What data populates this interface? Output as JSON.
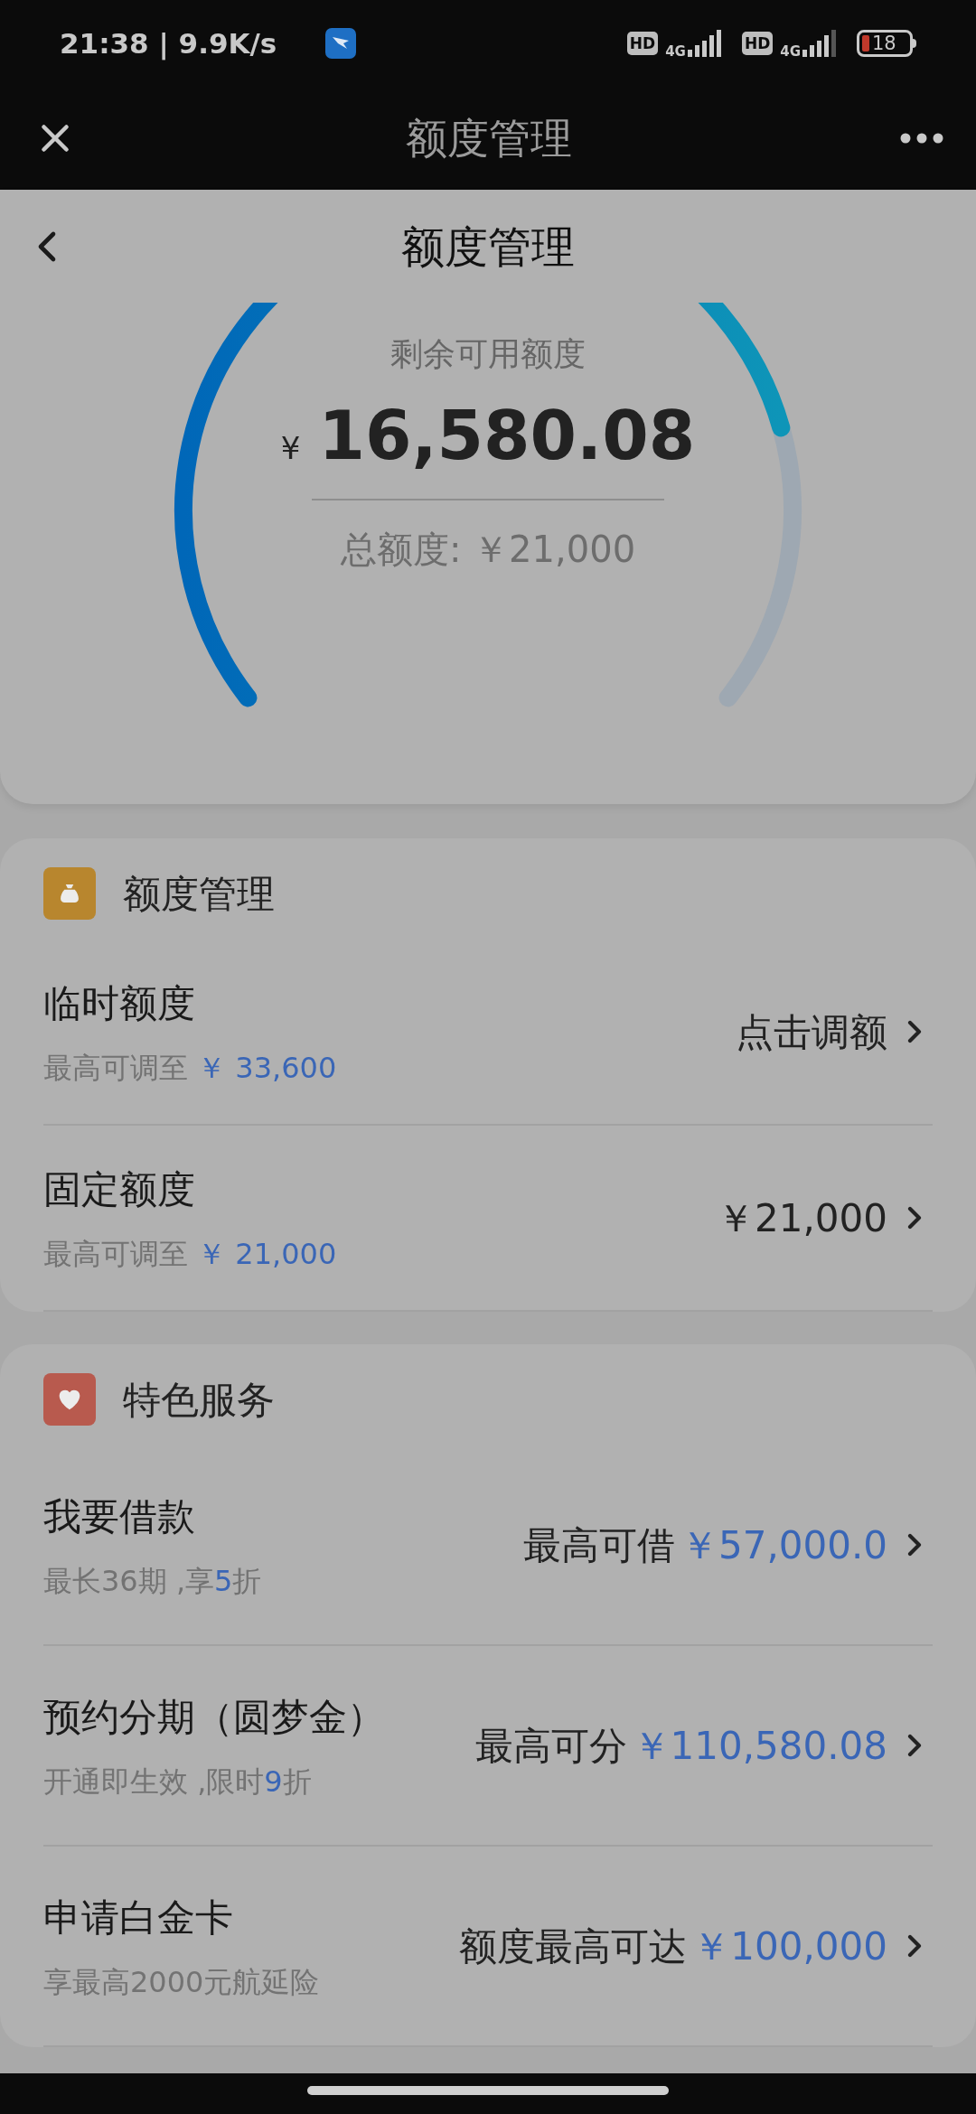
{
  "status_bar": {
    "time": "21:38 | 9.9K/s",
    "sims": [
      {
        "badge": "HD",
        "network": "4G"
      },
      {
        "badge": "HD",
        "network": "4G"
      }
    ],
    "battery": "18"
  },
  "top_bar": {
    "title": "额度管理"
  },
  "header": {
    "title": "额度管理"
  },
  "gauge": {
    "label": "剩余可用额度",
    "currency": "¥",
    "amount": "16,580.08",
    "total": "总额度: ￥21,000"
  },
  "sections": [
    {
      "title": "额度管理",
      "color": "#b8862e",
      "rows": [
        {
          "title": "临时额度",
          "subtitle": [
            {
              "text": "最高可调至 ",
              "kind": "plain"
            },
            {
              "text": "￥ 33,600",
              "kind": "accent"
            }
          ],
          "right": [
            {
              "text": "点击调额",
              "kind": "plain"
            }
          ]
        },
        {
          "title": "固定额度",
          "subtitle": [
            {
              "text": "最高可调至 ",
              "kind": "plain"
            },
            {
              "text": "￥ 21,000",
              "kind": "accent"
            }
          ],
          "right": [
            {
              "text": "￥21,000",
              "kind": "plain"
            }
          ]
        }
      ]
    },
    {
      "title": "特色服务",
      "color": "#b85a4e",
      "rows": [
        {
          "title": "我要借款",
          "subtitle": [
            {
              "text": "最长36期 ,享",
              "kind": "plain"
            },
            {
              "text": "5",
              "kind": "accent"
            },
            {
              "text": "折",
              "kind": "plain"
            }
          ],
          "right": [
            {
              "text": "最高可借",
              "kind": "plain"
            },
            {
              "text": "￥57,000.0",
              "kind": "accent"
            }
          ]
        },
        {
          "title": "预约分期（圆梦金）",
          "subtitle": [
            {
              "text": "开通即生效 ,限时",
              "kind": "plain"
            },
            {
              "text": "9",
              "kind": "accent"
            },
            {
              "text": "折",
              "kind": "plain"
            }
          ],
          "right": [
            {
              "text": "最高可分",
              "kind": "plain"
            },
            {
              "text": "￥110,580.08",
              "kind": "accent"
            }
          ]
        },
        {
          "title": "申请白金卡",
          "subtitle": [
            {
              "text": "享最高2000元航延险",
              "kind": "plain"
            }
          ],
          "right": [
            {
              "text": "额度最高可达",
              "kind": "plain"
            },
            {
              "text": "￥100,000",
              "kind": "accent"
            }
          ]
        }
      ]
    }
  ]
}
